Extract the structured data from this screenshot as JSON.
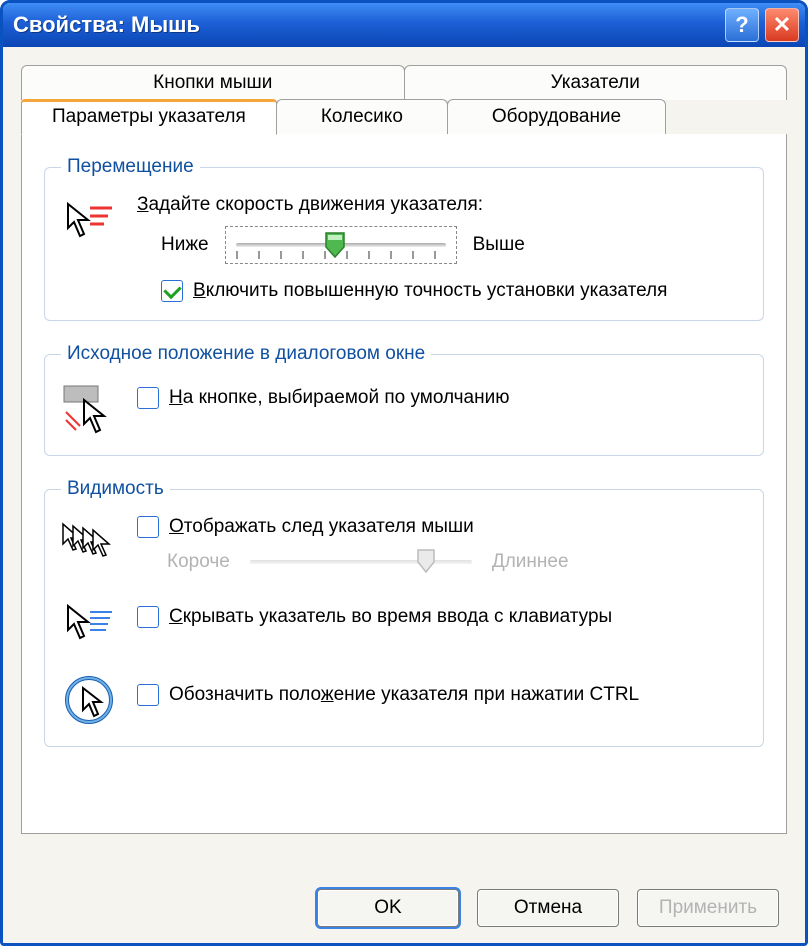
{
  "title": "Свойства: Мышь",
  "tabs_row1": [
    "Кнопки мыши",
    "Указатели"
  ],
  "tabs_row2": [
    "Параметры указателя",
    "Колесико",
    "Оборудование"
  ],
  "active_tab": "Параметры указателя",
  "groups": {
    "motion": {
      "legend": "Перемещение",
      "label_prefix": "З",
      "label_rest": "адайте скорость движения указателя:",
      "slider_low": "Ниже",
      "slider_high": "Выше",
      "slider_value": 5,
      "slider_max": 10,
      "precision_checked": true,
      "precision_prefix": "В",
      "precision_rest": "ключить повышенную точность установки указателя"
    },
    "snap": {
      "legend": "Исходное положение в диалоговом окне",
      "checked": false,
      "label_prefix": "Н",
      "label_rest": "а кнопке, выбираемой по умолчанию"
    },
    "visibility": {
      "legend": "Видимость",
      "trails_checked": false,
      "trails_prefix": "О",
      "trails_rest": "тображать след указателя мыши",
      "trails_low": "Короче",
      "trails_high": "Длиннее",
      "trails_value": 8,
      "trails_max": 10,
      "hide_checked": false,
      "hide_prefix": "С",
      "hide_rest": "крывать указатель во время ввода с клавиатуры",
      "ctrl_checked": false,
      "ctrl_mid_u": "ж",
      "ctrl_pre": "Обозначить поло",
      "ctrl_post": "ение указателя при нажатии CTRL"
    }
  },
  "buttons": {
    "ok": "OK",
    "cancel": "Отмена",
    "apply": "Применить"
  }
}
